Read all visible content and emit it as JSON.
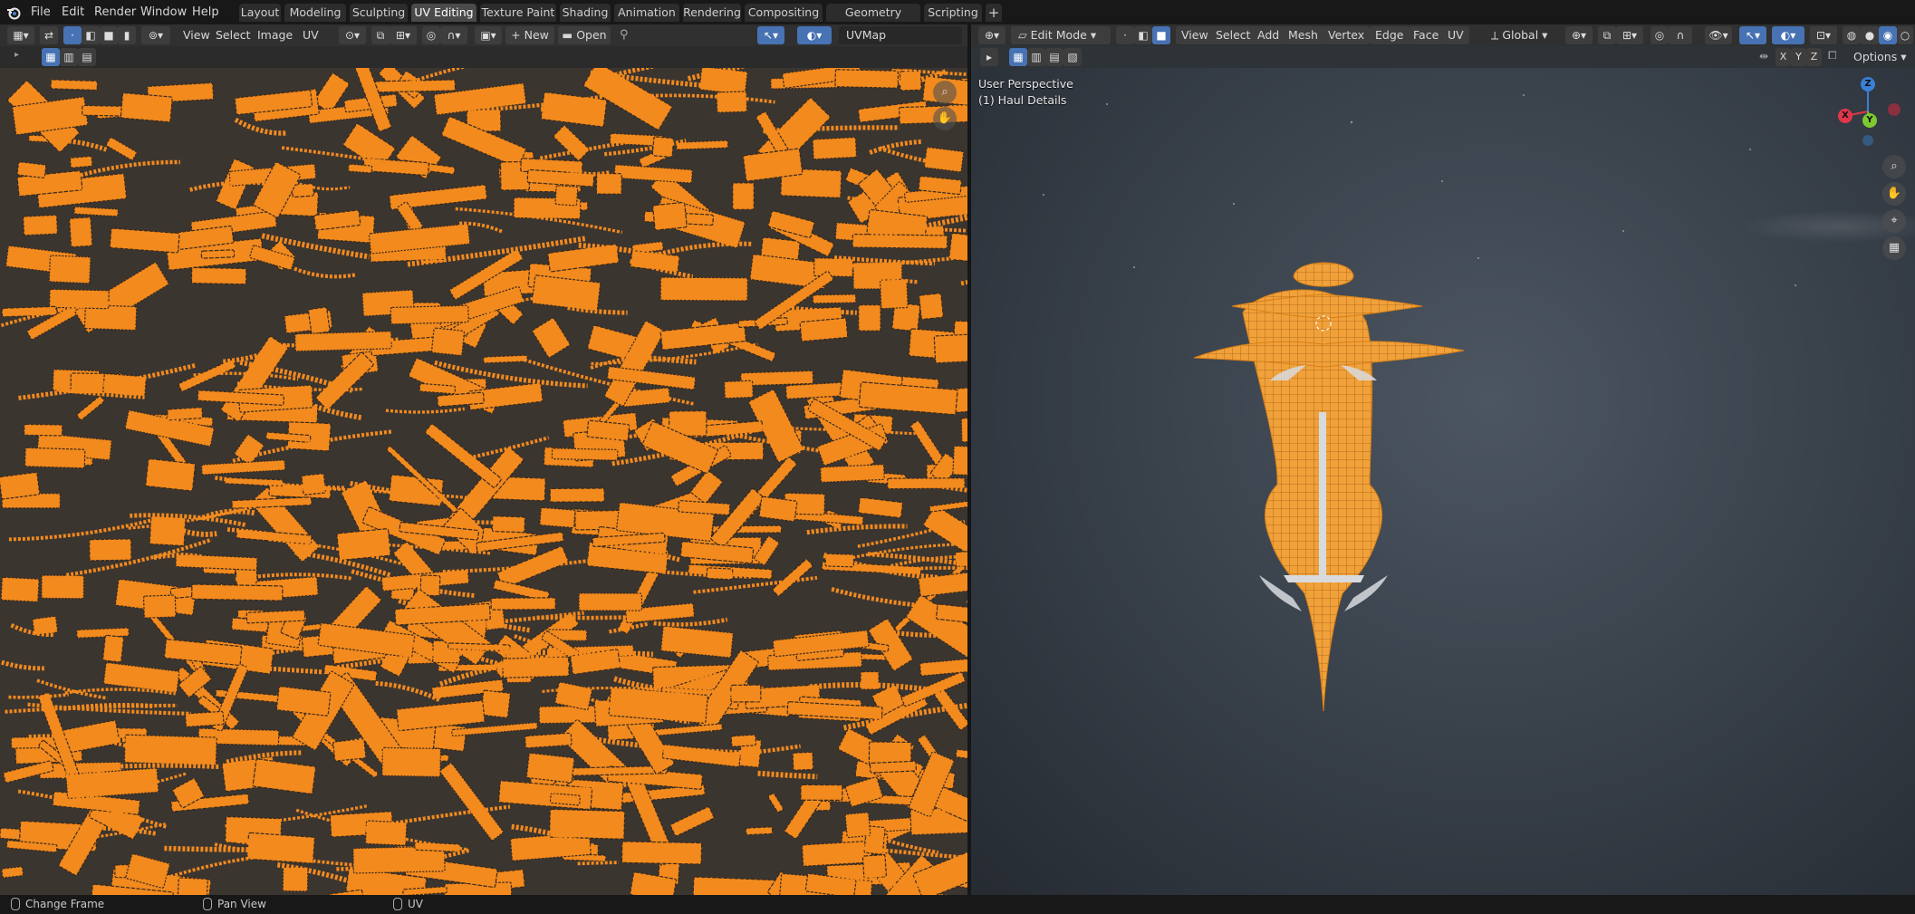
{
  "app": {
    "logo": "blender-logo-icon"
  },
  "menubar": [
    "File",
    "Edit",
    "Render",
    "Window",
    "Help"
  ],
  "workspaces": [
    "Layout",
    "Modeling",
    "Sculpting",
    "UV Editing",
    "Texture Paint",
    "Shading",
    "Animation",
    "Rendering",
    "Compositing",
    "Geometry Nodes",
    "Scripting"
  ],
  "active_workspace": "UV Editing",
  "uv_editor": {
    "menus": [
      "View",
      "Select",
      "Image",
      "UV"
    ],
    "new_label": "New",
    "open_label": "Open",
    "uvmap_name": "UVMap",
    "island_color": "#f28a1e",
    "bg_color": "#3b3530"
  },
  "viewport": {
    "mode": "Edit Mode",
    "menus": [
      "View",
      "Select",
      "Add",
      "Mesh",
      "Vertex",
      "Edge",
      "Face",
      "UV"
    ],
    "orientation": "Global",
    "options_label": "Options",
    "mirror_axes": [
      "X",
      "Y",
      "Z"
    ],
    "overlay_line1": "User Perspective",
    "overlay_line2": "(1) Haul Details",
    "gizmo": {
      "x": "X",
      "y": "Y",
      "z": "Z",
      "x_color": "#e0374a",
      "y_color": "#7ec832",
      "z_color": "#3a7fd6"
    },
    "mesh_color": "#f0a13a"
  },
  "status": {
    "left": "Change Frame",
    "middle": "Pan View",
    "right": "UV"
  }
}
